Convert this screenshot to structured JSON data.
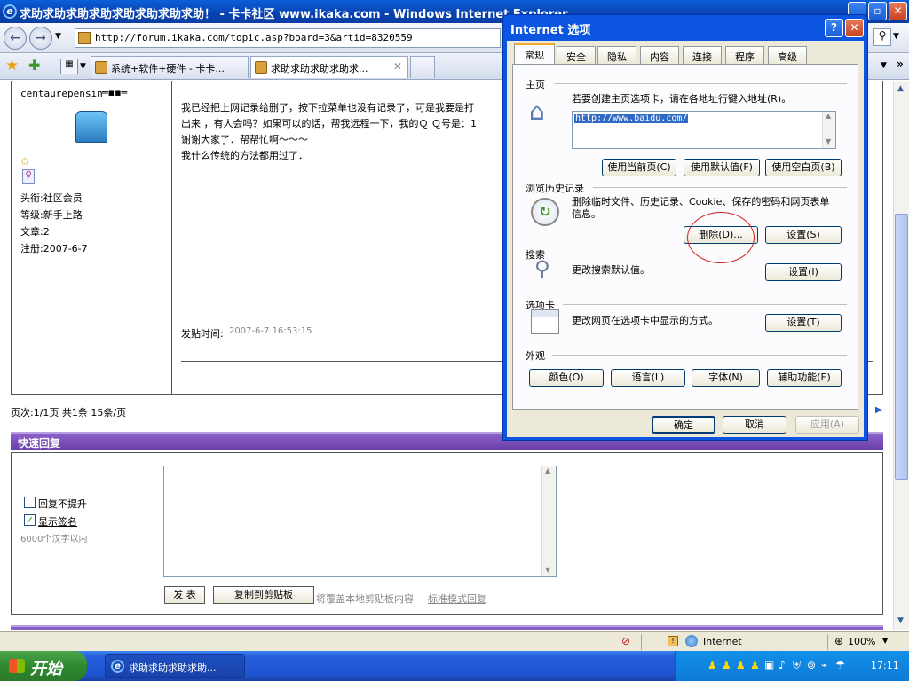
{
  "browser": {
    "window_title": "求助求助求助求助求助求助求助求助！ - 卡卡社区 www.ikaka.com - Windows Internet Explorer",
    "address": "http://forum.ikaka.com/topic.asp?board=3&artid=8320559",
    "tabs": [
      {
        "label": "系统+软件+硬件 - 卡卡..."
      },
      {
        "label": "求助求助求助求助求..."
      }
    ],
    "zoom": "100%",
    "zone": "Internet",
    "status_right_text": "Internet"
  },
  "post": {
    "author": "centaurepensin",
    "rank_title": "头衔:社区会员",
    "level": "等级:新手上路",
    "articles": "文章:2",
    "registered": "注册:2007-6-7",
    "lines": [
      "我已经把上网记录给删了，按下拉菜单也没有记录了，可是我要是打",
      "出来 ，有人会吗？如果可以的话，帮我远程一下，我的Ｑ Ｑ号是：1",
      "谢谢大家了．帮帮忙啊～～～",
      "我什么传统的方法都用过了．"
    ],
    "post_time_label": "发贴时间:",
    "post_time": "2007-6-7 16:53:15",
    "pager": "页次:1/1页 共1条 15条/页"
  },
  "quick_reply": {
    "header": "快速回复",
    "no_bump_label": "回复不提升",
    "show_signature_label": "显示签名",
    "show_signature_checked": true,
    "no_bump_checked": false,
    "limit_text": "6000个汉字以内",
    "submit_label": "发 表",
    "copy_label": "复制到剪贴板",
    "hint_text": "将覆盖本地剪贴板内容",
    "standard_mode_link": "标准模式回复"
  },
  "dialog": {
    "title": "Internet 选项",
    "tabs": [
      "常规",
      "安全",
      "隐私",
      "内容",
      "连接",
      "程序",
      "高级"
    ],
    "active_tab": "常规",
    "home": {
      "heading": "主页",
      "desc": "若要创建主页选项卡，请在各地址行键入地址(R)。",
      "url": "http://www.baidu.com/",
      "btn_current": "使用当前页(C)",
      "btn_default": "使用默认值(F)",
      "btn_blank": "使用空白页(B)"
    },
    "history": {
      "heading": "浏览历史记录",
      "desc": "删除临时文件、历史记录、Cookie、保存的密码和网页表单信息。",
      "btn_delete": "删除(D)...",
      "btn_settings": "设置(S)"
    },
    "search": {
      "heading": "搜索",
      "desc": "更改搜索默认值。",
      "btn_settings": "设置(I)"
    },
    "tabs_section": {
      "heading": "选项卡",
      "desc": "更改网页在选项卡中显示的方式。",
      "btn_settings": "设置(T)"
    },
    "appearance": {
      "heading": "外观",
      "btn_colors": "颜色(O)",
      "btn_languages": "语言(L)",
      "btn_fonts": "字体(N)",
      "btn_accessibility": "辅助功能(E)"
    },
    "ok": "确定",
    "cancel": "取消",
    "apply": "应用(A)"
  },
  "taskbar": {
    "start": "开始",
    "task": "求助求助求助求助...",
    "clock": "17:11"
  }
}
